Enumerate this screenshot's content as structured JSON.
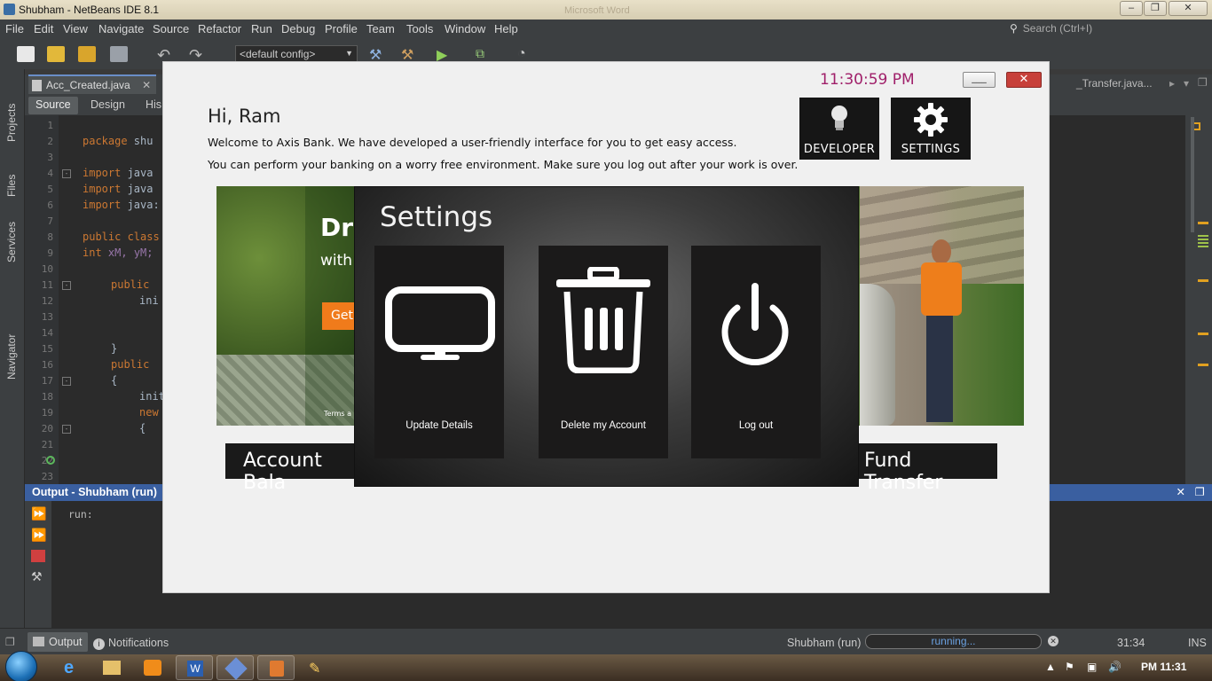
{
  "window": {
    "title": "Shubham - NetBeans IDE 8.1",
    "ghost_title": "Microsoft Word",
    "controls": {
      "minimize": "–",
      "maximize": "❐",
      "close": "✕"
    }
  },
  "menu": {
    "items": [
      "File",
      "Edit",
      "View",
      "Navigate",
      "Source",
      "Refactor",
      "Run",
      "Debug",
      "Profile",
      "Team",
      "Tools",
      "Window",
      "Help"
    ],
    "search_placeholder": "Search (Ctrl+I)"
  },
  "toolbar": {
    "config_value": "<default config>"
  },
  "side_tabs": [
    "Projects",
    "Files",
    "Services",
    "Navigator"
  ],
  "editor": {
    "tab_label": "Acc_Created.java",
    "tab_close": "✕",
    "right_tab_label": "_Transfer.java...",
    "subtabs": [
      "Source",
      "Design",
      "His"
    ],
    "line_numbers": [
      "1",
      "2",
      "3",
      "4",
      "5",
      "6",
      "7",
      "8",
      "9",
      "10",
      "11",
      "12",
      "13",
      "14",
      "15",
      "16",
      "17",
      "18",
      "19",
      "20",
      "21",
      "22",
      "23"
    ],
    "code_lines": {
      "l2_kw": "package",
      "l2_rest": " shu",
      "l4_kw": "import",
      "l4_rest": " java",
      "l5_kw": "import",
      "l5_rest": " java",
      "l6_kw": "import",
      "l6_rest": " java:",
      "l8_kw": "public class",
      "l9_kw": "int",
      "l9_f1": " xM,",
      "l9_f2": " yM;",
      "l11_kw": "public ",
      "l12": "ini",
      "l15": "}",
      "l16_kw": "public ",
      "l17": "{",
      "l18": "init",
      "l19_kw": "new",
      "l20": "{"
    }
  },
  "output": {
    "title": "Output - Shubham (run)",
    "close": "✕",
    "text": "run:"
  },
  "statusbar": {
    "output_tab": "Output",
    "notifications_tab": "Notifications",
    "process": "Shubham (run)",
    "progress_text": "running...",
    "position": "31:34",
    "mode": "INS"
  },
  "taskbar": {
    "clock": "PM 11:31"
  },
  "bank_app": {
    "clock": "11:30:59 PM",
    "min_label": "___",
    "close_label": "✕",
    "greeting": "Hi, Ram",
    "welcome_line1": "Welcome to Axis Bank. We have developed a user-friendly interface for you to get easy access.",
    "welcome_line2": "You can perform your banking on a worry free environment. Make sure you log out after your work is over.",
    "tiles": {
      "developer": "DEVELOPER",
      "settings": "SETTINGS"
    },
    "banner": {
      "headline": "Dri",
      "subline": "with",
      "cta": "Get",
      "terms": "Terms a"
    },
    "account_button": "Account Bala",
    "fund_button": "Fund Transfer"
  },
  "settings_dialog": {
    "title": "Settings",
    "cards": [
      {
        "label": "Update Details",
        "icon": "monitor-icon"
      },
      {
        "label": "Delete my Account",
        "icon": "trash-icon"
      },
      {
        "label": "Log out",
        "icon": "power-icon"
      }
    ]
  },
  "colors": {
    "ide_bg": "#2b2b2b",
    "ide_panel": "#3c3f41",
    "output_header": "#3a5fa0",
    "clock_text": "#a0206a",
    "close_red": "#c7403a",
    "banner_orange": "#f07b1b"
  }
}
